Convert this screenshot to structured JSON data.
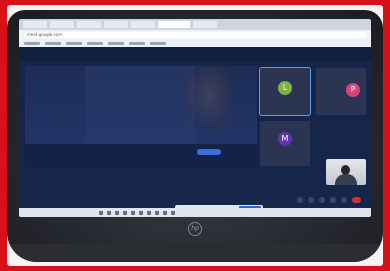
{
  "browser": {
    "tabs": [
      "",
      "",
      "",
      "",
      "",
      "",
      ""
    ],
    "url": "meet.google.com"
  },
  "meeting": {
    "title": "",
    "code": "",
    "banner_text": "",
    "banner_button": "",
    "banner_link": ""
  },
  "participants": [
    {
      "initial": "L",
      "name": "",
      "color": "#7cb342"
    },
    {
      "initial": "P",
      "name": "",
      "color": "#d8437a"
    },
    {
      "initial": "M",
      "name": "",
      "color": "#5e35b1"
    }
  ],
  "controls": [
    "mic-icon",
    "camera-icon",
    "captions-icon",
    "present-icon",
    "more-icon",
    "end-call-icon"
  ],
  "laptop_logo": "hp",
  "colors": {
    "border": "#d8101a",
    "meet_background": "#16264a",
    "accent": "#3b6fd8",
    "end_call": "#c7342c"
  }
}
